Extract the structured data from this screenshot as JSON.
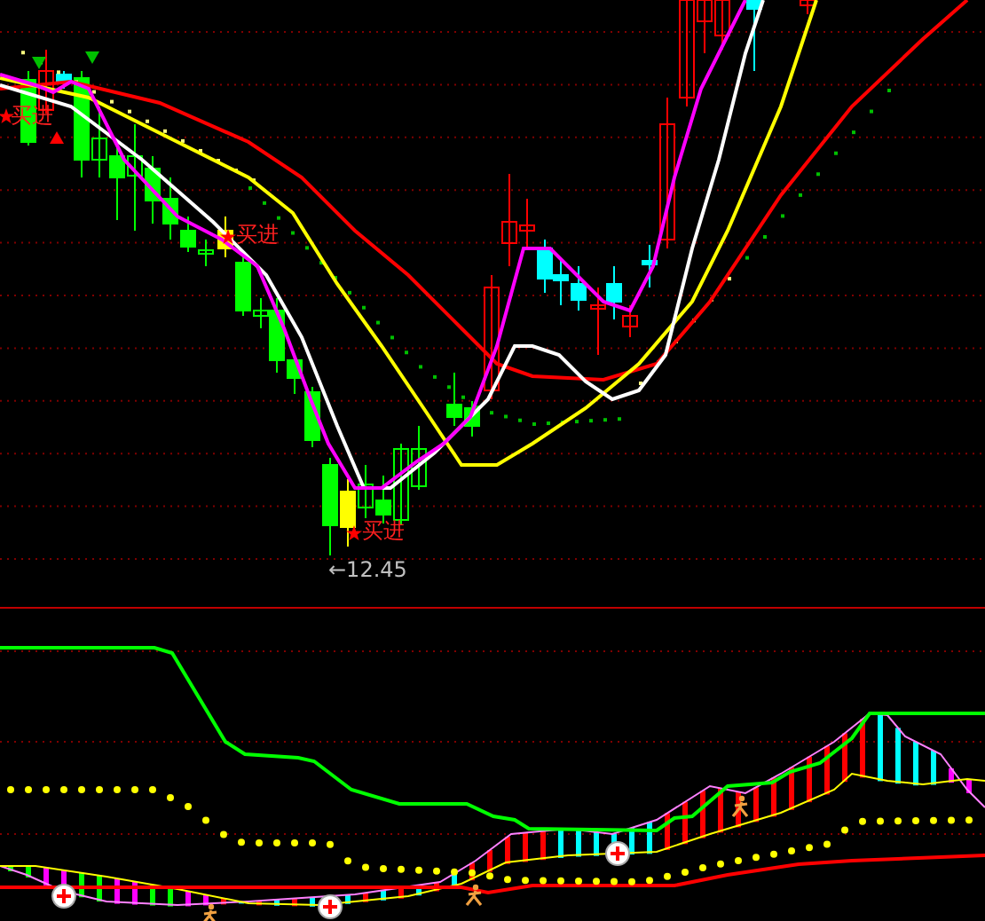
{
  "price_panel": {
    "signals": [
      {
        "label": "买进"
      },
      {
        "label": "买进"
      },
      {
        "label": "买进"
      }
    ],
    "low_marker": {
      "label": "←12.45"
    }
  }
}
